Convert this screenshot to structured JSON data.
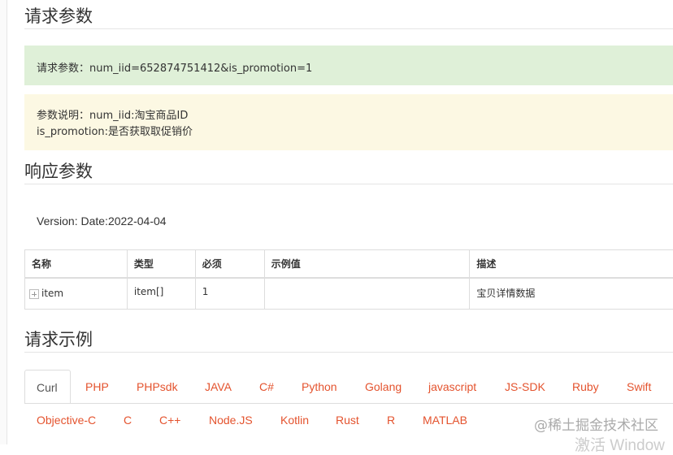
{
  "request_params": {
    "title": "请求参数",
    "query": "请求参数：num_iid=652874751412&is_promotion=1",
    "desc_line1": "参数说明：num_iid:淘宝商品ID",
    "desc_line2": "is_promotion:是否获取取促销价"
  },
  "response_params": {
    "title": "响应参数",
    "version": "Version: Date:2022-04-04",
    "table": {
      "headers": [
        "名称",
        "类型",
        "必须",
        "示例值",
        "描述"
      ],
      "rows": [
        {
          "name": "item",
          "type": "item[]",
          "required": "1",
          "example": "",
          "desc": "宝贝详情数据"
        }
      ]
    }
  },
  "request_example": {
    "title": "请求示例",
    "tabs_row1": [
      "Curl",
      "PHP",
      "PHPsdk",
      "JAVA",
      "C#",
      "Python",
      "Golang",
      "javascript",
      "JS-SDK",
      "Ruby",
      "Swift"
    ],
    "tabs_row2": [
      "Objective-C",
      "C",
      "C++",
      "Node.JS",
      "Kotlin",
      "Rust",
      "R",
      "MATLAB"
    ],
    "active_tab": "Curl"
  },
  "watermark": "@稀土掘金技术社区",
  "os_overlay": "激活 Window",
  "colors": {
    "tab_link": "#e4532e",
    "alert_success": "#dff0d8",
    "alert_warning": "#fcf8e3"
  }
}
